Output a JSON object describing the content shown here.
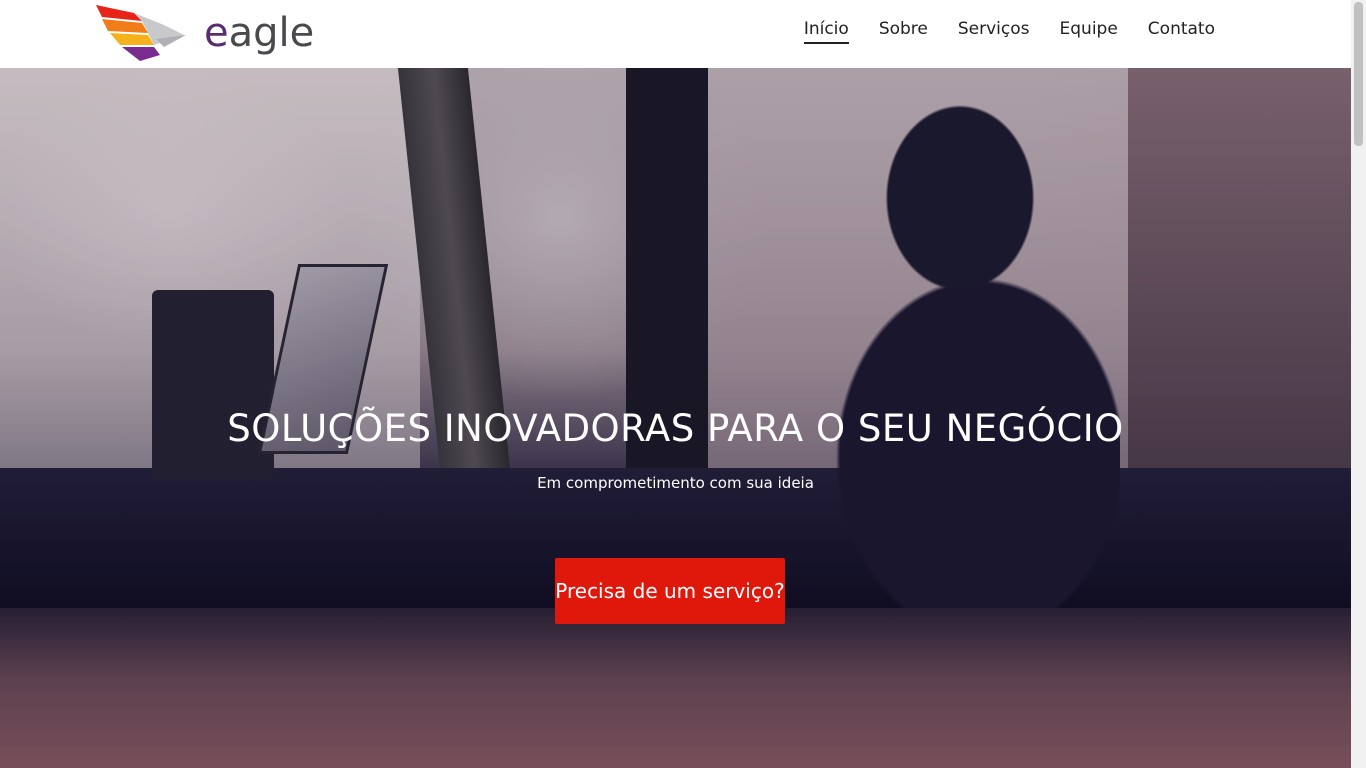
{
  "brand": {
    "logo_first_letter": "e",
    "logo_rest": "agle"
  },
  "nav": {
    "items": [
      {
        "label": "Início",
        "active": true
      },
      {
        "label": "Sobre",
        "active": false
      },
      {
        "label": "Serviços",
        "active": false
      },
      {
        "label": "Equipe",
        "active": false
      },
      {
        "label": "Contato",
        "active": false
      }
    ]
  },
  "hero": {
    "title": "SOLUÇÕES INOVADORAS PARA O SEU NEGÓCIO",
    "subtitle": "Em comprometimento com sua ideia",
    "cta_label": "Precisa de um serviço?"
  },
  "colors": {
    "cta": "#e0180c",
    "logo_text": "#4a4a4e",
    "logo_accent_purple": "#5a2d6e"
  },
  "icons": {
    "logo": "eagle-wing-logo-icon"
  }
}
